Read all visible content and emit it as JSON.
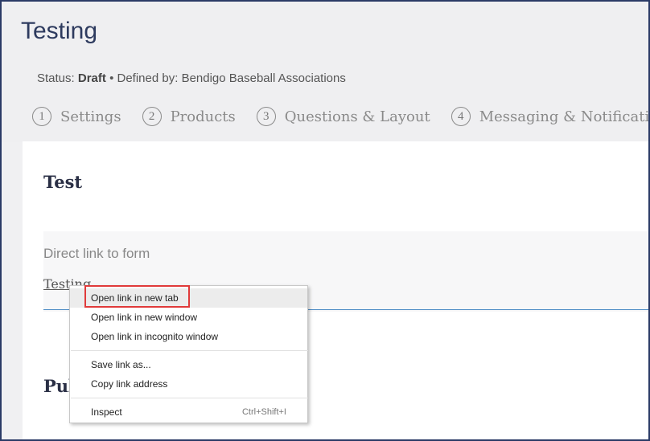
{
  "page": {
    "title": "Testing"
  },
  "status": {
    "label": "Status:",
    "value": "Draft",
    "separator": "•",
    "defined_by_label": "Defined by:",
    "defined_by_value": "Bendigo Baseball Associations"
  },
  "steps": [
    {
      "number": "1",
      "label": "Settings"
    },
    {
      "number": "2",
      "label": "Products"
    },
    {
      "number": "3",
      "label": "Questions & Layout"
    },
    {
      "number": "4",
      "label": "Messaging & Notifications"
    }
  ],
  "main": {
    "form_name": "Test",
    "direct_link_label": "Direct link to form",
    "direct_link_text": "Testing",
    "next_section_partial": "Pub"
  },
  "context_menu": {
    "items": [
      {
        "label": "Open link in new tab"
      },
      {
        "label": "Open link in new window"
      },
      {
        "label": "Open link in incognito window"
      },
      {
        "label": "Save link as..."
      },
      {
        "label": "Copy link address"
      },
      {
        "label": "Inspect",
        "shortcut": "Ctrl+Shift+I"
      }
    ]
  },
  "colors": {
    "title": "#2d3a5e",
    "frame_border": "#2a3a66",
    "link_underline": "#4a8ac4",
    "highlight": "#e03a3a"
  }
}
